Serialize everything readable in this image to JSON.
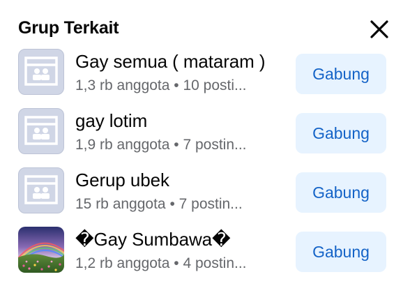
{
  "header": {
    "title": "Grup Terkait"
  },
  "groups": [
    {
      "name": "Gay semua ( mataram )",
      "meta": "1,3 rb anggota • 10 posti...",
      "join_label": "Gabung",
      "thumbnail": "group-placeholder-icon"
    },
    {
      "name": "gay lotim",
      "meta": "1,9 rb anggota • 7 postin...",
      "join_label": "Gabung",
      "thumbnail": "group-placeholder-icon"
    },
    {
      "name": "Gerup ubek",
      "meta": "15 rb anggota • 7 postin...",
      "join_label": "Gabung",
      "thumbnail": "group-placeholder-icon"
    },
    {
      "name": "�Gay Sumbawa�",
      "meta": "1,2 rb anggota • 4 postin...",
      "join_label": "Gabung",
      "thumbnail": "rainbow-landscape-photo"
    }
  ],
  "colors": {
    "join_bg": "#e7f3ff",
    "join_text": "#1463c7",
    "meta_text": "#65676b",
    "placeholder_bg": "#d0d6e6"
  }
}
